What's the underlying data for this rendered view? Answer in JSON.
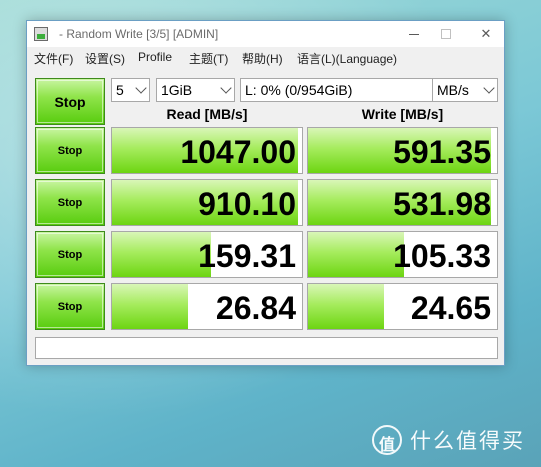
{
  "window": {
    "title": "- Random Write [3/5] [ADMIN]",
    "minimize_icon": "minimize-icon",
    "maximize_icon": "maximize-icon",
    "close_glyph": "✕"
  },
  "menu": {
    "items": [
      "文件(F)",
      "设置(S)",
      "Profile",
      "主题(T)",
      "帮助(H)",
      "语言(L)(Language)"
    ]
  },
  "controls": {
    "main_button": "Stop",
    "count": "5",
    "size": "1GiB",
    "drive": "L: 0% (0/954GiB)",
    "unit": "MB/s"
  },
  "headers": {
    "read": "Read [MB/s]",
    "write": "Write [MB/s]"
  },
  "rows": [
    {
      "button": "Stop",
      "read": "1047.00",
      "write": "591.35",
      "read_level": 0.98,
      "write_level": 0.97
    },
    {
      "button": "Stop",
      "read": "910.10",
      "write": "531.98",
      "read_level": 0.98,
      "write_level": 0.97
    },
    {
      "button": "Stop",
      "read": "159.31",
      "write": "105.33",
      "read_level": 0.52,
      "write_level": 0.51
    },
    {
      "button": "Stop",
      "read": "26.84",
      "write": "24.65",
      "read_level": 0.4,
      "write_level": 0.4
    }
  ],
  "comment": "",
  "watermark": {
    "icon_glyph": "值",
    "text": "什么值得买"
  },
  "colors": {
    "button_green": "#58cc0e",
    "bar_green": "#6dd512",
    "window_border": "#6b9fc4"
  }
}
